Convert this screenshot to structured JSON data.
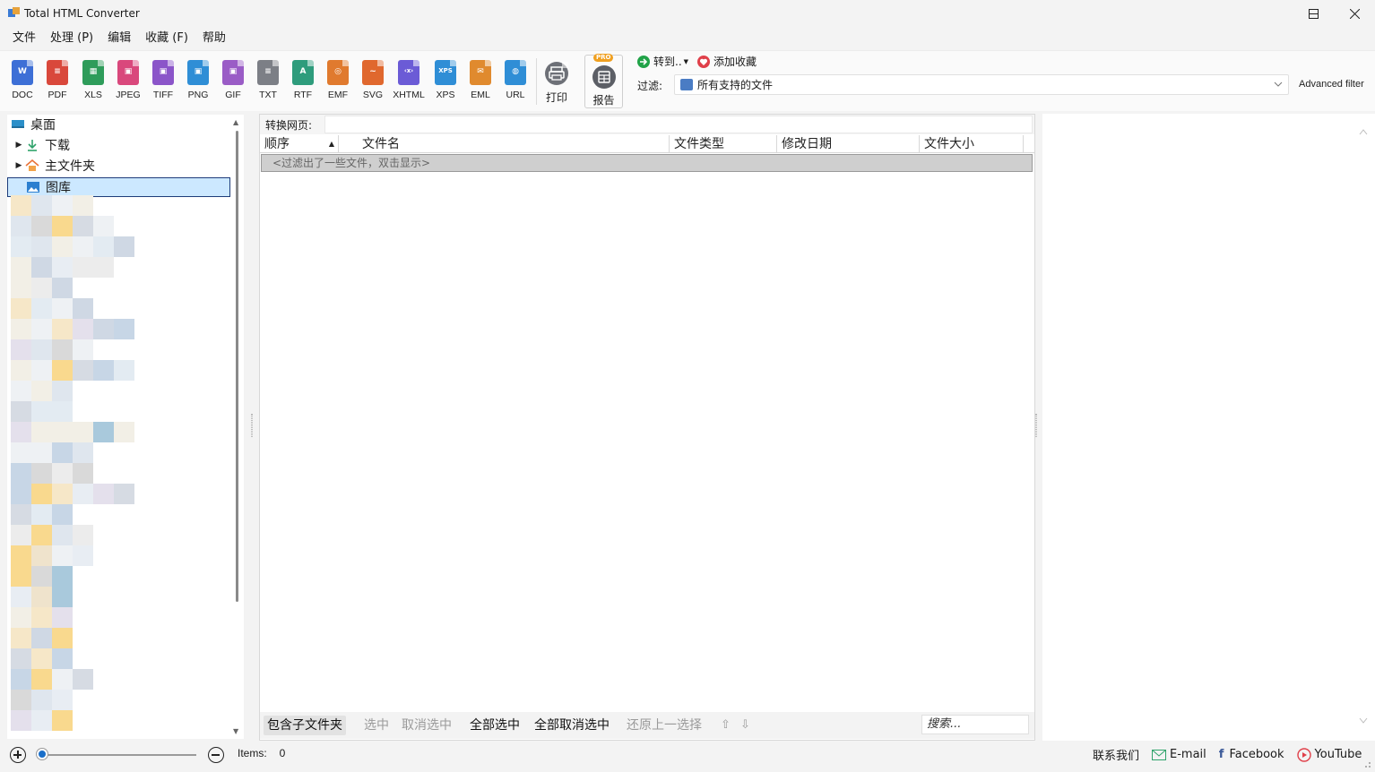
{
  "window": {
    "title": "Total HTML Converter",
    "controls": [
      "minimize",
      "maximize",
      "close"
    ]
  },
  "menu": [
    "文件",
    "处理 (P)",
    "编辑",
    "收藏 (F)",
    "帮助"
  ],
  "toolbar": {
    "formats": [
      {
        "label": "DOC",
        "icon": "doc-icon",
        "color": "#3d6fd6",
        "glyph": "W"
      },
      {
        "label": "PDF",
        "icon": "pdf-icon",
        "color": "#d9483b",
        "glyph": "≡"
      },
      {
        "label": "XLS",
        "icon": "xls-icon",
        "color": "#2e9c5a",
        "glyph": "▦"
      },
      {
        "label": "JPEG",
        "icon": "jpeg-icon",
        "color": "#d9487c",
        "glyph": "▣"
      },
      {
        "label": "TIFF",
        "icon": "tiff-icon",
        "color": "#8b55c9",
        "glyph": "▣"
      },
      {
        "label": "PNG",
        "icon": "png-icon",
        "color": "#2f8ed6",
        "glyph": "▣"
      },
      {
        "label": "GIF",
        "icon": "gif-icon",
        "color": "#9a5cc6",
        "glyph": "▣"
      },
      {
        "label": "TXT",
        "icon": "txt-icon",
        "color": "#7c7f86",
        "glyph": "≡"
      },
      {
        "label": "RTF",
        "icon": "rtf-icon",
        "color": "#2e9c7c",
        "glyph": "A"
      },
      {
        "label": "EMF",
        "icon": "emf-icon",
        "color": "#e07a2e",
        "glyph": "◎"
      },
      {
        "label": "SVG",
        "icon": "svg-icon",
        "color": "#e0682e",
        "glyph": "~"
      },
      {
        "label": "XHTML",
        "icon": "xhtml-icon",
        "color": "#6b5bd6",
        "glyph": "‹x›"
      },
      {
        "label": "XPS",
        "icon": "xps-icon",
        "color": "#2f8ed6",
        "glyph": "XPS"
      },
      {
        "label": "EML",
        "icon": "eml-icon",
        "color": "#e08a2e",
        "glyph": "✉"
      },
      {
        "label": "URL",
        "icon": "url-icon",
        "color": "#2f8ed6",
        "glyph": "◍"
      }
    ],
    "print_label": "打印",
    "report_label": "报告",
    "report_badge": "PRO",
    "goto_label": "转到..",
    "favorite_label": "添加收藏",
    "filter_label": "过滤:",
    "filter_value": "所有支持的文件",
    "advanced_filter": "Advanced filter"
  },
  "tree": {
    "items": [
      {
        "label": "桌面",
        "icon": "desktop-icon",
        "expandable": false
      },
      {
        "label": "下载",
        "icon": "download-icon",
        "expandable": true
      },
      {
        "label": "主文件夹",
        "icon": "home-icon",
        "expandable": true
      },
      {
        "label": "图库",
        "icon": "gallery-icon",
        "expandable": false,
        "selected": true
      }
    ]
  },
  "center": {
    "url_label": "转换网页:",
    "url_value": "",
    "columns": [
      "顺序",
      "文件名",
      "文件类型",
      "修改日期",
      "文件大小"
    ],
    "sorted_column": "顺序",
    "filtered_notice": "<过滤出了一些文件，双击显示>",
    "actions": [
      {
        "label": "包含子文件夹",
        "enabled": true
      },
      {
        "label": "选中",
        "enabled": false
      },
      {
        "label": "取消选中",
        "enabled": false
      },
      {
        "label": "全部选中",
        "enabled": true
      },
      {
        "label": "全部取消选中",
        "enabled": true
      },
      {
        "label": "还原上一选择",
        "enabled": false
      }
    ],
    "search_placeholder": "搜索..."
  },
  "status": {
    "items_label": "Items:",
    "items_count": "0",
    "contact": "联系我们",
    "email": "E-mail",
    "facebook": "Facebook",
    "youtube": "YouTube"
  }
}
